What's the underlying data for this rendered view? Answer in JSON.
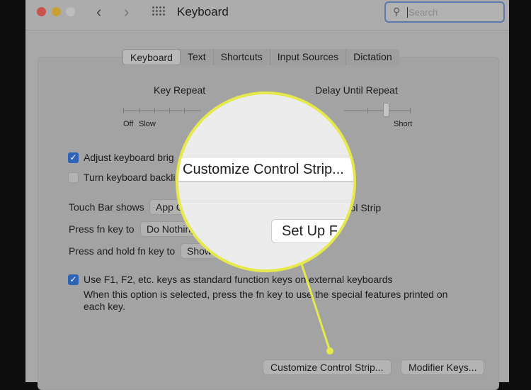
{
  "window": {
    "title": "Keyboard",
    "search_placeholder": "Search"
  },
  "tabs": [
    {
      "label": "Keyboard",
      "selected": true
    },
    {
      "label": "Text"
    },
    {
      "label": "Shortcuts"
    },
    {
      "label": "Input Sources"
    },
    {
      "label": "Dictation"
    }
  ],
  "key_repeat": {
    "label": "Key Repeat",
    "min_labels": [
      "Off",
      "Slow"
    ]
  },
  "delay_until_repeat": {
    "label": "Delay Until Repeat",
    "max_label": "Short"
  },
  "options": {
    "adjust_brightness": {
      "label": "Adjust keyboard brig",
      "checked": true
    },
    "backlight": {
      "label": "Turn keyboard backli",
      "checked": false
    },
    "touch_bar": {
      "label": "Touch Bar shows",
      "value": "App Co",
      "trail": "trol Strip"
    },
    "fn_key": {
      "label": "Press fn key to",
      "value": "Do Nothing"
    },
    "hold_fn": {
      "label": "Press and hold fn key to",
      "value": "Show F1, F2,"
    },
    "use_f_keys": {
      "label": "Use F1, F2, etc. keys as standard function keys on external keyboards",
      "checked": true,
      "description": "When this option is selected, press the fn key to use the special features printed on each key."
    }
  },
  "buttons": {
    "customize": "Customize Control Strip...",
    "modifier": "Modifier Keys..."
  },
  "magnifier": {
    "customize": "Customize Control Strip...",
    "setup": "Set Up F"
  },
  "colors": {
    "accent": "#2f63b8",
    "highlight": "#e6e84b"
  }
}
